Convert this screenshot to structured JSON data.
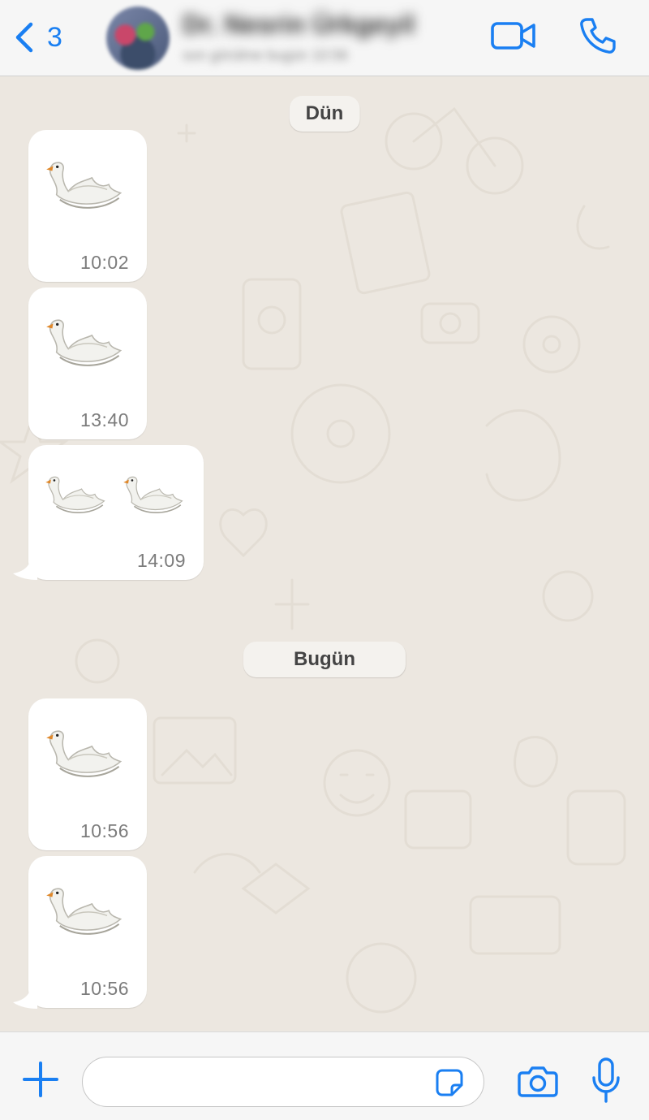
{
  "header": {
    "back_count": "3",
    "contact_name": "Dr. Nesrin Ürkgeyil",
    "contact_status": "son görülme bugün 10:56"
  },
  "colors": {
    "accent": "#1a7ff2",
    "chat_background": "#ece7e0",
    "bubble_incoming": "#ffffff",
    "timestamp": "#7c7c7c"
  },
  "icons": {
    "back": "chevron-left-icon",
    "video": "video-camera-icon",
    "call": "phone-icon",
    "add": "plus-icon",
    "sticker": "sticker-icon",
    "camera": "camera-icon",
    "mic": "microphone-icon",
    "swan": "swan-emoji"
  },
  "chat": {
    "dates": [
      "Dün",
      "Bugün"
    ],
    "messages": [
      {
        "emoji": "🦢",
        "count": 1,
        "time": "10:02"
      },
      {
        "emoji": "🦢",
        "count": 1,
        "time": "13:40"
      },
      {
        "emoji": "🦢",
        "count": 2,
        "time": "14:09"
      },
      {
        "emoji": "🦢",
        "count": 1,
        "time": "10:56"
      },
      {
        "emoji": "🦢",
        "count": 1,
        "time": "10:56"
      }
    ]
  },
  "composer": {
    "placeholder": ""
  }
}
